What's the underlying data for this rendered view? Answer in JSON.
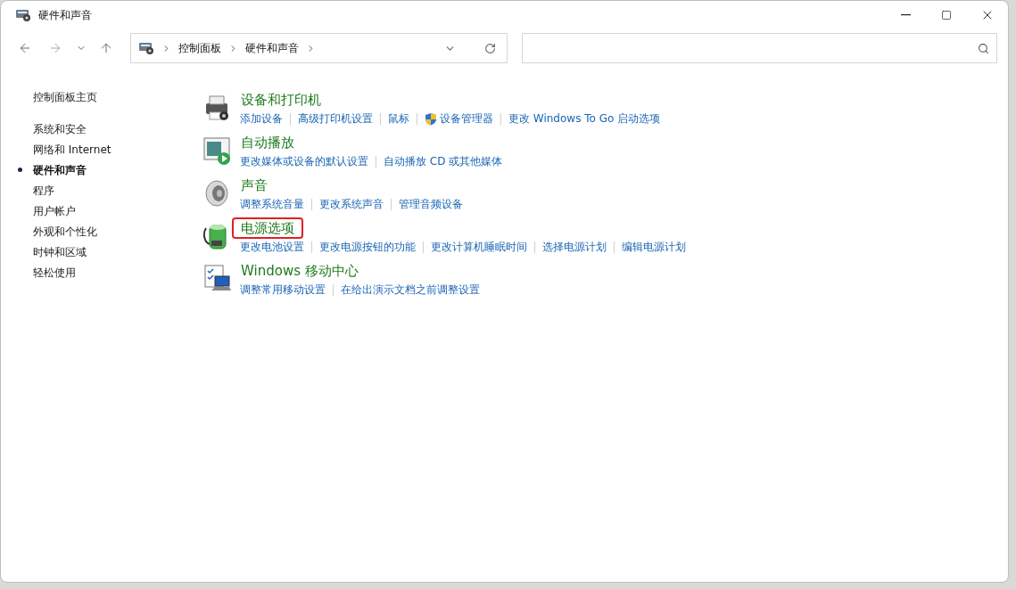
{
  "window": {
    "title": "硬件和声音"
  },
  "breadcrumb": [
    "控制面板",
    "硬件和声音"
  ],
  "sidebar": {
    "home": "控制面板主页",
    "items": [
      {
        "label": "系统和安全",
        "selected": false
      },
      {
        "label": "网络和 Internet",
        "selected": false
      },
      {
        "label": "硬件和声音",
        "selected": true
      },
      {
        "label": "程序",
        "selected": false
      },
      {
        "label": "用户帐户",
        "selected": false
      },
      {
        "label": "外观和个性化",
        "selected": false
      },
      {
        "label": "时钟和区域",
        "selected": false
      },
      {
        "label": "轻松使用",
        "selected": false
      }
    ]
  },
  "categories": [
    {
      "kind": "printer",
      "title": "设备和打印机",
      "highlighted": false,
      "links": [
        {
          "label": "添加设备",
          "shield": false
        },
        {
          "label": "高级打印机设置",
          "shield": false
        },
        {
          "label": "鼠标",
          "shield": false
        },
        {
          "label": "设备管理器",
          "shield": true
        },
        {
          "label": "更改 Windows To Go 启动选项",
          "shield": false
        }
      ]
    },
    {
      "kind": "autoplay",
      "title": "自动播放",
      "highlighted": false,
      "links": [
        {
          "label": "更改媒体或设备的默认设置",
          "shield": false
        },
        {
          "label": "自动播放 CD 或其他媒体",
          "shield": false
        }
      ]
    },
    {
      "kind": "sound",
      "title": "声音",
      "highlighted": false,
      "links": [
        {
          "label": "调整系统音量",
          "shield": false
        },
        {
          "label": "更改系统声音",
          "shield": false
        },
        {
          "label": "管理音频设备",
          "shield": false
        }
      ]
    },
    {
      "kind": "power",
      "title": "电源选项",
      "highlighted": true,
      "links": [
        {
          "label": "更改电池设置",
          "shield": false
        },
        {
          "label": "更改电源按钮的功能",
          "shield": false
        },
        {
          "label": "更改计算机睡眠时间",
          "shield": false
        },
        {
          "label": "选择电源计划",
          "shield": false
        },
        {
          "label": "编辑电源计划",
          "shield": false
        }
      ]
    },
    {
      "kind": "mobility",
      "title": "Windows 移动中心",
      "highlighted": false,
      "links": [
        {
          "label": "调整常用移动设置",
          "shield": false
        },
        {
          "label": "在给出演示文档之前调整设置",
          "shield": false
        }
      ]
    }
  ]
}
